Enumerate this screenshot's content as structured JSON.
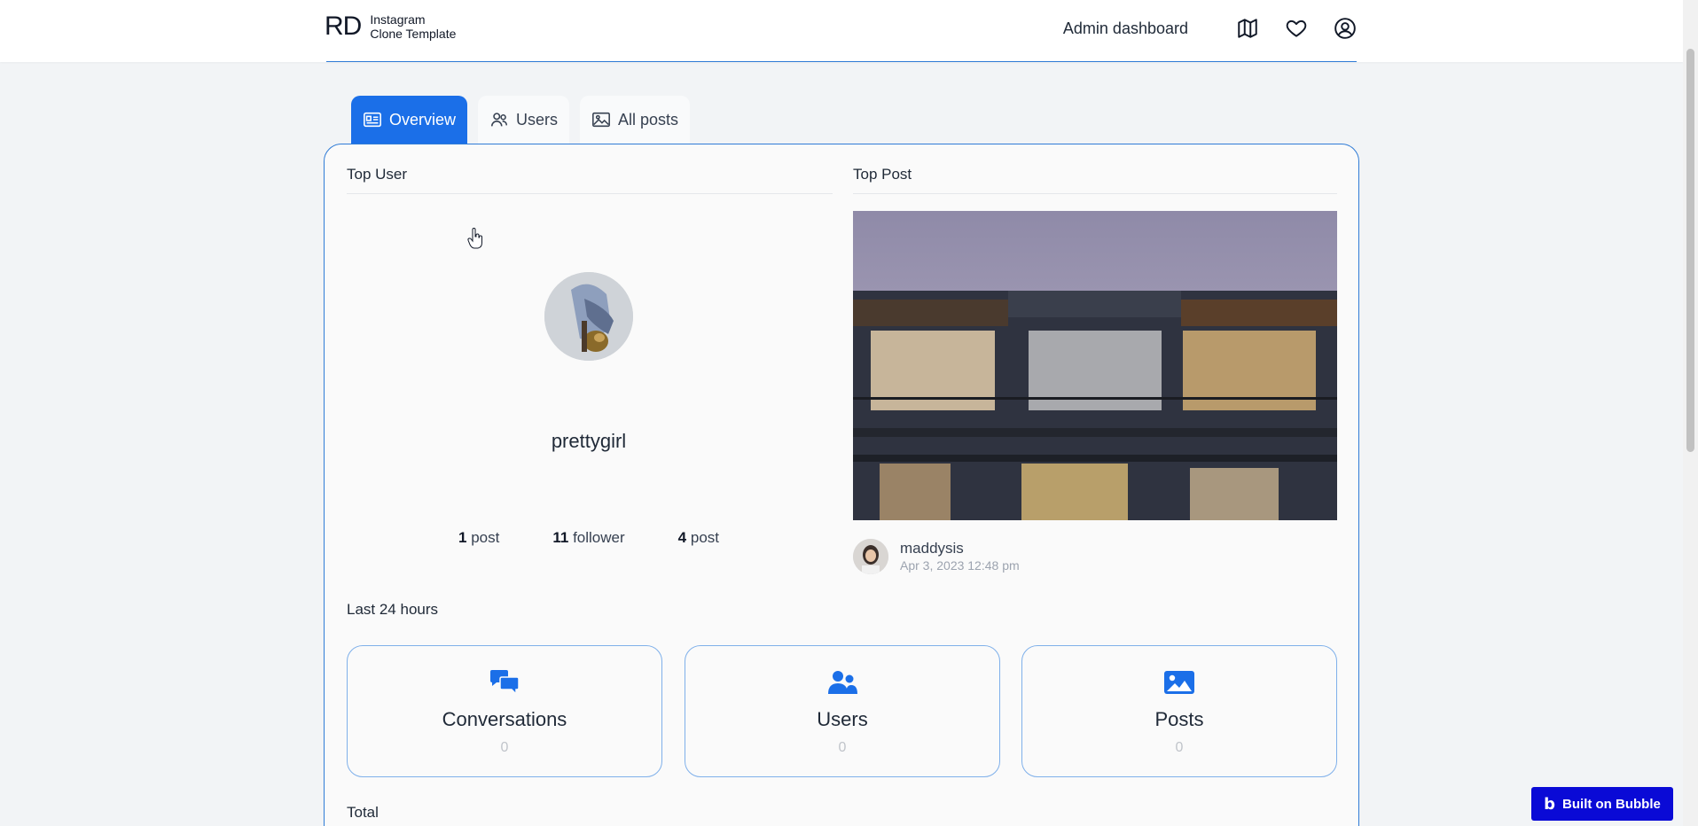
{
  "header": {
    "logo_mark": "RD",
    "logo_line1": "Instagram",
    "logo_line2": "Clone Template",
    "admin_link": "Admin dashboard",
    "icons": [
      "map-icon",
      "heart-icon",
      "account-icon"
    ]
  },
  "tabs": [
    {
      "label": "Overview",
      "icon": "id-card-icon",
      "active": true
    },
    {
      "label": "Users",
      "icon": "users-icon",
      "active": false
    },
    {
      "label": "All posts",
      "icon": "image-icon",
      "active": false
    }
  ],
  "top_user": {
    "title": "Top User",
    "username": "prettygirl",
    "stats": [
      {
        "value": "1",
        "label": "post"
      },
      {
        "value": "11",
        "label": "follower"
      },
      {
        "value": "4",
        "label": "post"
      }
    ]
  },
  "top_post": {
    "title": "Top Post",
    "author": "maddysis",
    "date": "Apr 3, 2023 12:48 pm"
  },
  "last_24": {
    "title": "Last 24 hours",
    "cards": [
      {
        "label": "Conversations",
        "count": "0",
        "icon": "chat-icon"
      },
      {
        "label": "Users",
        "count": "0",
        "icon": "users-icon"
      },
      {
        "label": "Posts",
        "count": "0",
        "icon": "image-icon"
      }
    ]
  },
  "total": {
    "title": "Total"
  },
  "badge": {
    "logo": "b",
    "label": "Built on Bubble"
  },
  "colors": {
    "accent": "#1b6fe8",
    "border": "#2f7bd6",
    "badge": "#0a0ad6"
  }
}
